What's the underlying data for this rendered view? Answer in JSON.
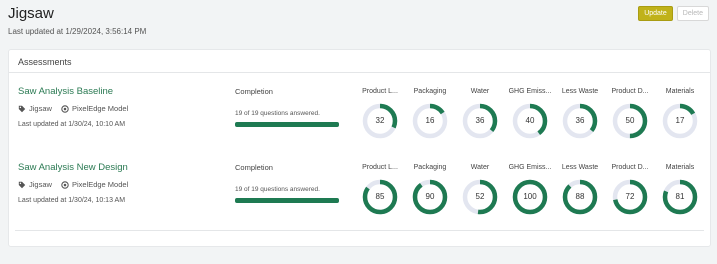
{
  "page": {
    "title": "Jigsaw",
    "last_updated": "Last updated at 1/29/2024, 3:56:14 PM"
  },
  "actions": {
    "update_label": "Update",
    "delete_label": "Delete"
  },
  "panel": {
    "title": "Assessments"
  },
  "colors": {
    "accent": "#2b7a53",
    "ring_fill": "#1e7a52",
    "ring_track": "#e3e6f0",
    "update_button": "#c0b21a"
  },
  "assessments": [
    {
      "name": "Saw Analysis Baseline",
      "tag_product": "Jigsaw",
      "tag_model": "PixelEdge Model",
      "last_updated": "Last updated at 1/30/24, 10:10 AM",
      "completion_label": "Completion",
      "completion_text": "19 of 19 questions answered.",
      "completion_fraction": 1.0,
      "metrics": [
        {
          "label": "Product L...",
          "value": "32",
          "fraction": 0.32
        },
        {
          "label": "Packaging",
          "value": "16",
          "fraction": 0.16
        },
        {
          "label": "Water",
          "value": "36",
          "fraction": 0.36
        },
        {
          "label": "GHG Emiss...",
          "value": "40",
          "fraction": 0.4
        },
        {
          "label": "Less Waste",
          "value": "36",
          "fraction": 0.36
        },
        {
          "label": "Product D...",
          "value": "50",
          "fraction": 0.5
        },
        {
          "label": "Materials",
          "value": "17",
          "fraction": 0.17
        }
      ]
    },
    {
      "name": "Saw Analysis New Design",
      "tag_product": "Jigsaw",
      "tag_model": "PixelEdge Model",
      "last_updated": "Last updated at 1/30/24, 10:13 AM",
      "completion_label": "Completion",
      "completion_text": "19 of 19 questions answered.",
      "completion_fraction": 1.0,
      "metrics": [
        {
          "label": "Product L...",
          "value": "85",
          "fraction": 0.85
        },
        {
          "label": "Packaging",
          "value": "90",
          "fraction": 0.9
        },
        {
          "label": "Water",
          "value": "52",
          "fraction": 0.52
        },
        {
          "label": "GHG Emiss...",
          "value": "100",
          "fraction": 1.0
        },
        {
          "label": "Less Waste",
          "value": "88",
          "fraction": 0.88
        },
        {
          "label": "Product D...",
          "value": "72",
          "fraction": 0.72
        },
        {
          "label": "Materials",
          "value": "81",
          "fraction": 0.81
        }
      ]
    }
  ]
}
